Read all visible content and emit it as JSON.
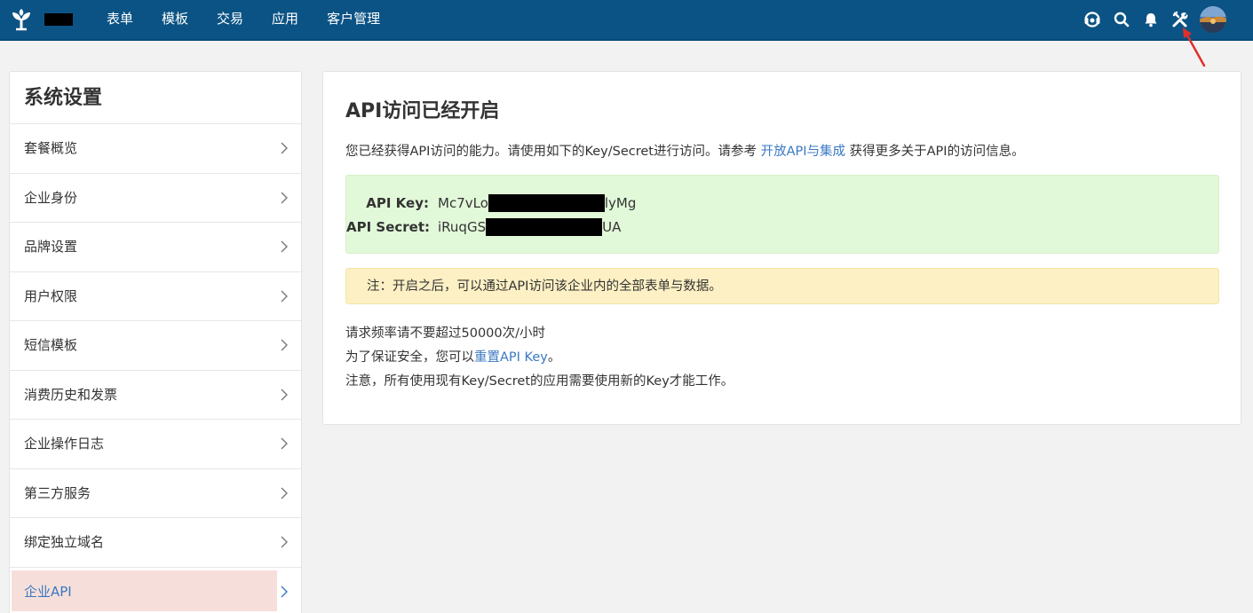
{
  "topbar": {
    "nav": [
      "表单",
      "模板",
      "交易",
      "应用",
      "客户管理"
    ],
    "icons": [
      "support-icon",
      "search-icon",
      "bell-icon",
      "tools-icon"
    ],
    "colors": {
      "background": "#0b5384",
      "text": "#ffffff"
    }
  },
  "sidebar": {
    "title": "系统设置",
    "items": [
      {
        "label": "套餐概览"
      },
      {
        "label": "企业身份"
      },
      {
        "label": "品牌设置"
      },
      {
        "label": "用户权限"
      },
      {
        "label": "短信模板"
      },
      {
        "label": "消费历史和发票"
      },
      {
        "label": "企业操作日志"
      },
      {
        "label": "第三方服务"
      },
      {
        "label": "绑定独立域名"
      },
      {
        "label": "企业API"
      }
    ],
    "active_index": 9,
    "colors": {
      "active_background": "#f6dfda",
      "active_text": "#3a78c3"
    }
  },
  "main": {
    "title": "API访问已经开启",
    "desc_prefix": "您已经获得API访问的能力。请使用如下的Key/Secret进行访问。请参考 ",
    "desc_link": "开放API与集成",
    "desc_suffix": " 获得更多关于API的访问信息。",
    "api_key_label": "API Key:",
    "api_key_start": "Mc7vLo",
    "api_key_end": "lyMg",
    "api_secret_label": "API Secret:",
    "api_secret_start": "iRuqGS",
    "api_secret_end": "UA",
    "note": "注：开启之后，可以通过API访问该企业内的全部表单与数据。",
    "rate_limit": "请求频率请不要超过50000次/小时",
    "reset_prefix": "为了保证安全，您可以",
    "reset_link": "重置API Key",
    "reset_suffix": "。",
    "warning": "注意，所有使用现有Key/Secret的应用需要使用新的Key才能工作。",
    "colors": {
      "link": "#3a78c3",
      "key_box": "#e2f9d9",
      "note_box": "#fdf0c4"
    }
  }
}
